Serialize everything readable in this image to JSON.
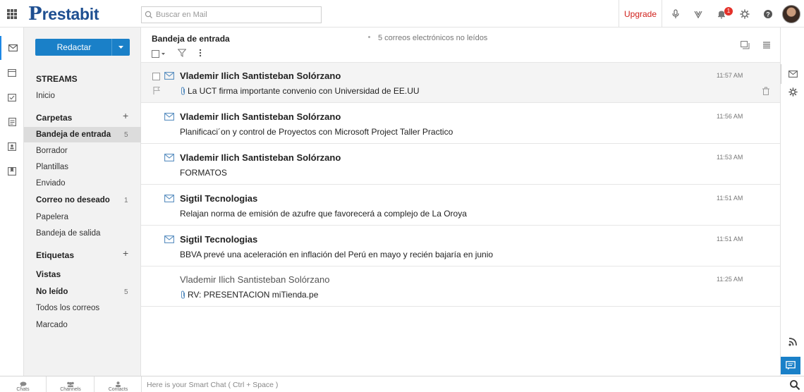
{
  "app": {
    "logo_text": "restabit",
    "logo_initial": "P"
  },
  "search": {
    "placeholder": "Buscar en Mail",
    "icon": "search-icon"
  },
  "topbar": {
    "upgrade_label": "Upgrade",
    "notification_count": "1",
    "icons": [
      "microphone-icon",
      "heart-icon",
      "bell-icon",
      "gear-icon",
      "help-icon"
    ]
  },
  "rail": {
    "items": [
      "mail-icon",
      "calendar-icon",
      "tasks-icon",
      "notes-icon",
      "contacts-icon",
      "bookmarks-icon"
    ]
  },
  "sidebar": {
    "compose_label": "Redactar",
    "streams_title": "STREAMS",
    "streams": [
      {
        "label": "Inicio"
      }
    ],
    "folders_title": "Carpetas",
    "folders": [
      {
        "label": "Bandeja de entrada",
        "count": "5"
      },
      {
        "label": "Borrador",
        "count": ""
      },
      {
        "label": "Plantillas",
        "count": ""
      },
      {
        "label": "Enviado",
        "count": ""
      },
      {
        "label": "Correo no deseado",
        "count": "1"
      },
      {
        "label": "Papelera",
        "count": ""
      },
      {
        "label": "Bandeja de salida",
        "count": ""
      }
    ],
    "tags_title": "Etiquetas",
    "views_title": "Vistas",
    "views": [
      {
        "label": "No leído",
        "count": "5"
      },
      {
        "label": "Todos los correos",
        "count": ""
      },
      {
        "label": "Marcado",
        "count": ""
      }
    ]
  },
  "main": {
    "title": "Bandeja de entrada",
    "unread_summary": "5 correos electrónicos no leídos",
    "emails": [
      {
        "sender": "Vlademir Ilich Santisteban Solórzano",
        "subject": "La UCT firma importante convenio con Universidad de EE.UU",
        "time": "11:57 AM",
        "unread": true,
        "attachment": true
      },
      {
        "sender": "Vlademir Ilich Santisteban Solórzano",
        "subject": "Planificaci´on y control de Proyectos con Microsoft Project Taller Practico",
        "time": "11:56 AM",
        "unread": true,
        "attachment": false
      },
      {
        "sender": "Vlademir Ilich Santisteban Solórzano",
        "subject": "FORMATOS",
        "time": "11:53 AM",
        "unread": true,
        "attachment": false
      },
      {
        "sender": "Sigtil Tecnologias",
        "subject": "Relajan norma de emisión de azufre que favorecerá a complejo de La Oroya",
        "time": "11:51 AM",
        "unread": true,
        "attachment": false
      },
      {
        "sender": "Sigtil Tecnologias",
        "subject": "BBVA prevé una aceleración en inflación del Perú en mayo y recién bajaría en junio",
        "time": "11:51 AM",
        "unread": true,
        "attachment": false
      },
      {
        "sender": "Vlademir Ilich Santisteban Solórzano",
        "subject": "RV: PRESENTACION miTienda.pe",
        "time": "11:25 AM",
        "unread": false,
        "attachment": true
      }
    ]
  },
  "bottombar": {
    "tabs": [
      {
        "label": "Chats"
      },
      {
        "label": "Channels"
      },
      {
        "label": "Contacts"
      }
    ],
    "smartchat_hint": "Here is your Smart Chat ( Ctrl + Space )"
  },
  "colors": {
    "brand": "#1e4f91",
    "accent": "#1a80c8",
    "upgrade": "#d0211c",
    "badge": "#e4312a"
  }
}
